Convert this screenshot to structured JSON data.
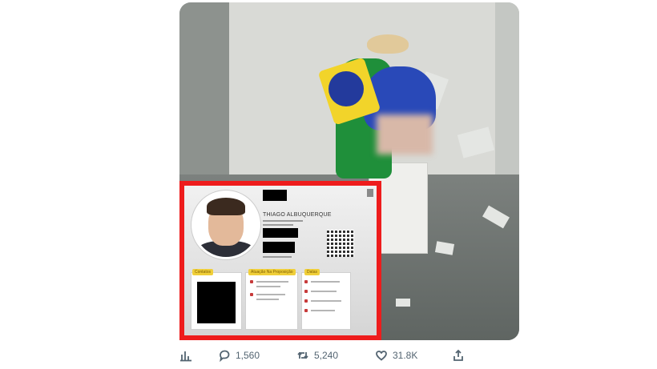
{
  "post": {
    "media": {
      "inset_card": {
        "name": "THIAGO ALBUQUERQUE",
        "sections": [
          "Contatos",
          "Atuação Na Proposição",
          "Datas"
        ]
      }
    },
    "actions": {
      "replies": "1,560",
      "reposts": "5,240",
      "likes": "31.8K"
    },
    "icons": [
      "analytics-icon",
      "reply-icon",
      "repost-icon",
      "like-icon",
      "share-icon"
    ],
    "colors": {
      "highlight_frame": "#ee1c1c",
      "action_text": "#536471"
    }
  }
}
